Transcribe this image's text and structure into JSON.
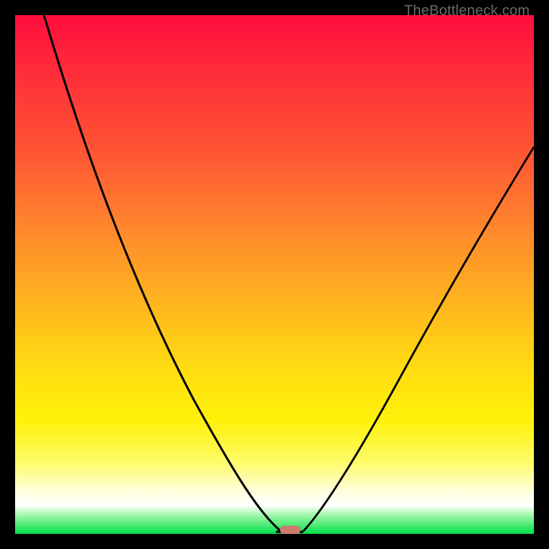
{
  "watermark": "TheBottleneck.com",
  "chart_data": {
    "type": "line",
    "title": "",
    "xlabel": "",
    "ylabel": "",
    "xlim": [
      0,
      100
    ],
    "ylim": [
      0,
      100
    ],
    "grid": false,
    "legend": false,
    "curve_description": "V-shaped bottleneck curve with minimum near x≈52",
    "series": [
      {
        "name": "bottleneck",
        "x": [
          5,
          10,
          15,
          20,
          25,
          30,
          35,
          40,
          44,
          47,
          50,
          52,
          54,
          58,
          62,
          68,
          75,
          82,
          90,
          100
        ],
        "y": [
          100,
          90,
          80,
          70,
          60,
          50,
          40,
          28,
          18,
          10,
          4,
          0,
          2,
          8,
          16,
          28,
          42,
          55,
          66,
          75
        ]
      }
    ],
    "marker": {
      "x": 52,
      "y": 0,
      "color": "#cf7a6f"
    }
  },
  "colors": {
    "gradient_top": "#ff0d3e",
    "gradient_bottom": "#00e046",
    "curve": "#000000",
    "frame": "#000000",
    "marker": "#cf7a6f",
    "watermark": "#6b6b6b"
  }
}
